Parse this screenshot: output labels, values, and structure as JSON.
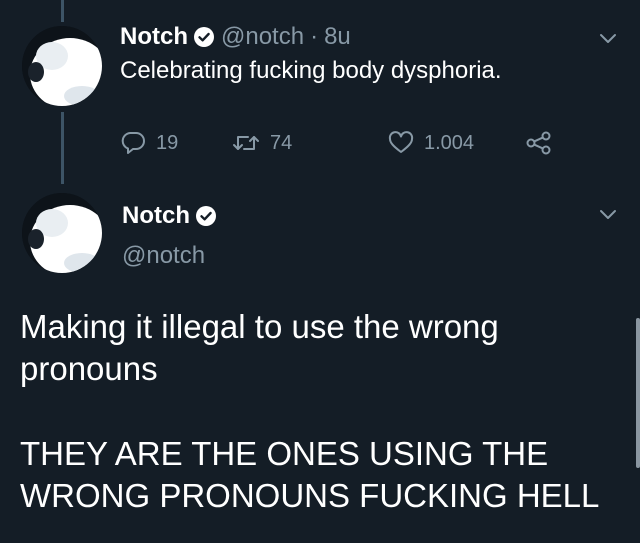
{
  "tweet_1": {
    "name": "Notch",
    "handle": "@notch",
    "separator": "·",
    "time": "8u",
    "text": "Celebrating fucking body dysphoria.",
    "replies": "19",
    "retweets": "74",
    "likes": "1.004"
  },
  "tweet_2": {
    "name": "Notch",
    "handle": "@notch",
    "text_line_1": "Making it illegal to use the wrong",
    "text_line_2": "pronouns",
    "text_line_3": "THEY ARE THE ONES USING THE",
    "text_line_4": "WRONG PRONOUNS FUCKING HELL"
  },
  "icons": {
    "verified": "verified-badge-icon",
    "reply": "reply-icon",
    "retweet": "retweet-icon",
    "like": "heart-icon",
    "share": "share-icon",
    "menu": "chevron-down-icon"
  },
  "colors": {
    "background": "#141d26",
    "secondary_text": "#8899a6",
    "thread_line": "#3d5466"
  }
}
